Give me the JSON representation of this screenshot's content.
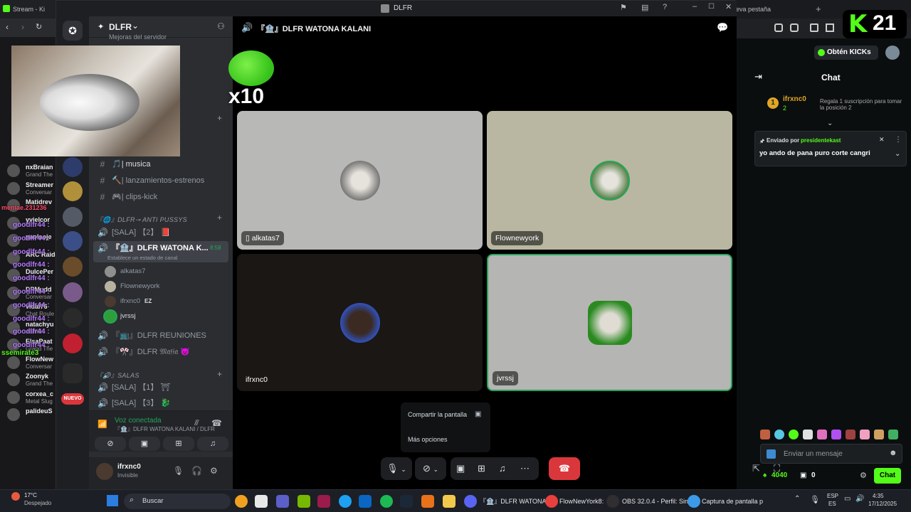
{
  "window": {
    "title": "DLFR"
  },
  "browser": {
    "tab1": "Stream - Ki",
    "tab_right": "eva pestaña",
    "kick_counter": "21",
    "get_kicks": "Obtén KICKs"
  },
  "left_rail": {
    "items": [
      {
        "name": "nxBraian",
        "sub": "Grand The"
      },
      {
        "name": "Streamer",
        "sub": "Conversar"
      },
      {
        "name": "Matidrev",
        "sub": ""
      },
      {
        "name": "yvielcor",
        "sub": ""
      },
      {
        "name": "paolaoje",
        "sub": ""
      },
      {
        "name": "ARC Raide",
        "sub": ""
      },
      {
        "name": "DulcePer",
        "sub": ""
      },
      {
        "name": "DPMudd",
        "sub": "Conversar"
      },
      {
        "name": "vidal76",
        "sub": "Chat Roule"
      },
      {
        "name": "natachyu",
        "sub": "ASMR"
      },
      {
        "name": "ElsaPaat",
        "sub": "Grand The"
      },
      {
        "name": "FlowNew",
        "sub": "Conversar"
      },
      {
        "name": "Zoonyk",
        "sub": "Grand The"
      },
      {
        "name": "corxea_c",
        "sub": "Metal Slug"
      },
      {
        "name": "palideuS",
        "sub": ""
      }
    ],
    "chat_overlay": [
      "goodlfr44 :",
      "goodlfr44 :",
      "goodlfr44 :",
      "goodlfr44 :",
      "goodlfr44 :",
      "goodlfr44 :",
      "goodlfr44 :",
      "goodlfr44 :",
      "goodlfr44 :",
      "goodlfr44 :"
    ],
    "overlay_user": "ssemirate3",
    "overlay_user2": "meniae.231236"
  },
  "server": {
    "name": "DLFR",
    "boost_line": "Mejoras del servidor",
    "channels_top": [
      {
        "icon": "#",
        "label": "🎵| musica"
      },
      {
        "icon": "#",
        "label": "🔨| lanzamientos-estrenos"
      },
      {
        "icon": "#",
        "label": "🎮| clips-kick"
      }
    ],
    "category1": "『🌐』DLFR⊸ ANTI PUSSYS",
    "voice_channels": [
      {
        "label": "[SALA] 【2】 📕"
      },
      {
        "label": "『🏦』DLFR WATONA K...",
        "time": "8:58",
        "status": "Establece un estado de canal"
      }
    ],
    "members": [
      {
        "name": "alkatas7"
      },
      {
        "name": "Flownewyork"
      },
      {
        "name": "ifrxnc0",
        "tag": "EZ"
      },
      {
        "name": "jvrssj"
      }
    ],
    "voice_channels2": [
      {
        "label": "『📺』DLFR REUNIONES"
      },
      {
        "label": "『🎌』DLFR 𝔐𝔞𝔣𝔦𝔞 😈"
      }
    ],
    "category2": "『🔊』SALAS",
    "voice_channels3": [
      {
        "label": "[SALA] 【1】 ⛩"
      },
      {
        "label": "[SALA] 【3】 🐉"
      }
    ],
    "nuevo": "NUEVO"
  },
  "voice_panel": {
    "status": "Voz conectada",
    "channel": "『🏦』DLFR WATONA KALANI / DLFR"
  },
  "user": {
    "name": "ifrxnc0",
    "status": "Invisible"
  },
  "stage": {
    "channel_title": "『🏦』DLFR WATONA KALANI",
    "emote_count": "x10",
    "tiles": [
      {
        "name": "alkatas7"
      },
      {
        "name": "Flownewyork"
      },
      {
        "name": "ifrxnc0"
      },
      {
        "name": "jvrssj"
      }
    ],
    "popup": {
      "share": "Compartir la pantalla",
      "more": "Más opciones"
    }
  },
  "kick_chat": {
    "title": "Chat",
    "top_user": "ifrxnc0",
    "top_rank": "1",
    "top_count": "2",
    "gift_text": "Regala 1 suscripción para tomar la posición 2",
    "pinned_by_prefix": "Enviado por",
    "pinned_by": "presidentekast",
    "pinned_message": "yo ando de pana puro corte cangri",
    "input_placeholder": "Enviar un mensaje",
    "kicks": "4040",
    "zero": "0",
    "send": "Chat"
  },
  "taskbar": {
    "weather_temp": "17°C",
    "weather_desc": "Despejado",
    "search": "Buscar",
    "apps": [
      {
        "label": "『🏦』DLFR WATONA K"
      },
      {
        "label": "FlowNewYork8:"
      },
      {
        "label": "OBS 32.0.4 - Perfil: Sin"
      },
      {
        "label": "Captura de pantalla p"
      }
    ],
    "lang1": "ESP",
    "lang2": "ES",
    "time": "4:35",
    "date": "17/12/2025"
  },
  "colors": {
    "kick_green": "#53fc18",
    "discord_bg": "#2b2d31",
    "hangup_red": "#da373c",
    "voice_green": "#23a55a"
  }
}
